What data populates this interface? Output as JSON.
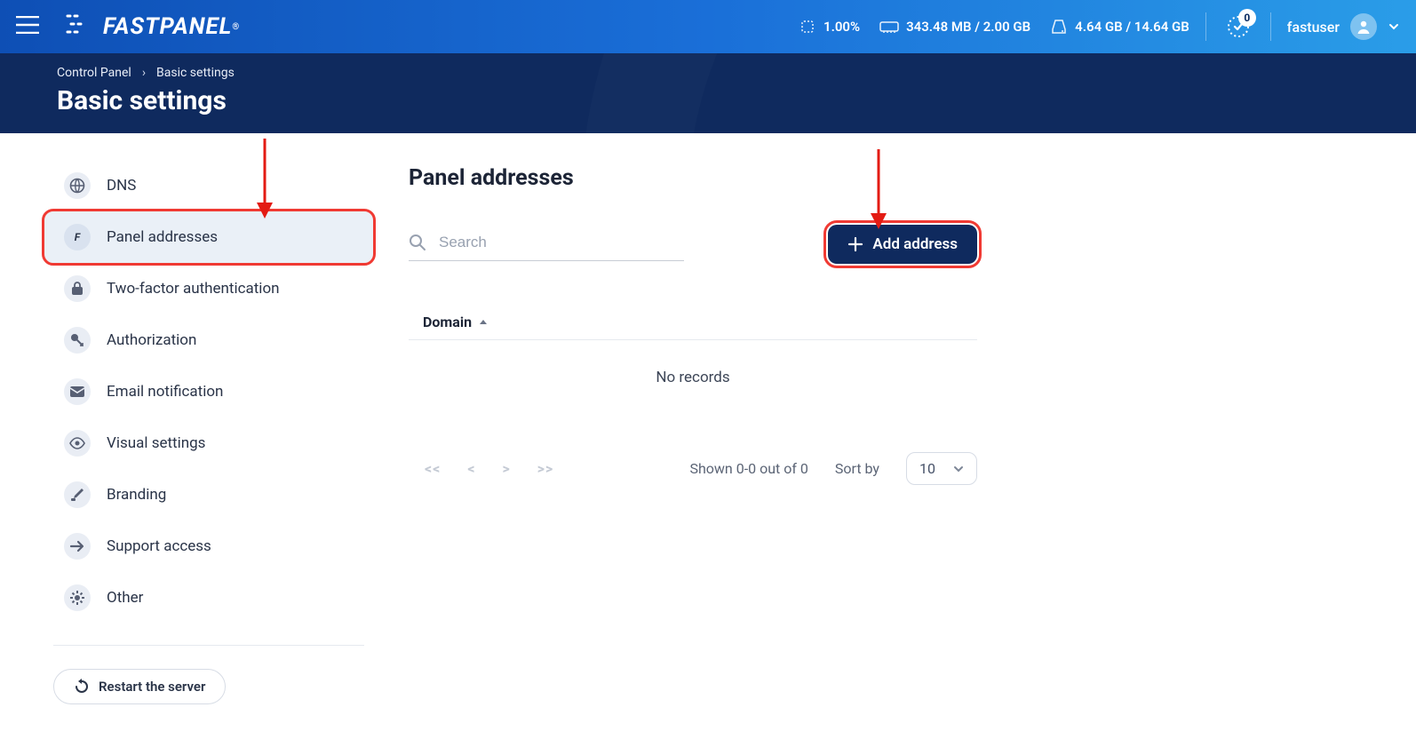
{
  "topbar": {
    "logo_text": "FASTPANEL",
    "stats": {
      "cpu": "1.00%",
      "mem": "343.48 MB / 2.00 GB",
      "disk": "4.64 GB / 14.64 GB"
    },
    "notif_count": "0",
    "username": "fastuser"
  },
  "breadcrumb": {
    "root": "Control Panel",
    "current": "Basic settings"
  },
  "page_title": "Basic settings",
  "sidebar": {
    "items": [
      {
        "label": "DNS"
      },
      {
        "label": "Panel addresses"
      },
      {
        "label": "Two-factor authentication"
      },
      {
        "label": "Authorization"
      },
      {
        "label": "Email notification"
      },
      {
        "label": "Visual settings"
      },
      {
        "label": "Branding"
      },
      {
        "label": "Support access"
      },
      {
        "label": "Other"
      }
    ],
    "restart_label": "Restart the server"
  },
  "content": {
    "title": "Panel addresses",
    "search_placeholder": "Search",
    "add_label": "Add address",
    "col_domain": "Domain",
    "no_records": "No records",
    "shown_text": "Shown 0-0 out of 0",
    "sort_by": "Sort by",
    "per_page": "10",
    "pager": {
      "first": "<<",
      "prev": "<",
      "next": ">",
      "last": ">>"
    }
  }
}
